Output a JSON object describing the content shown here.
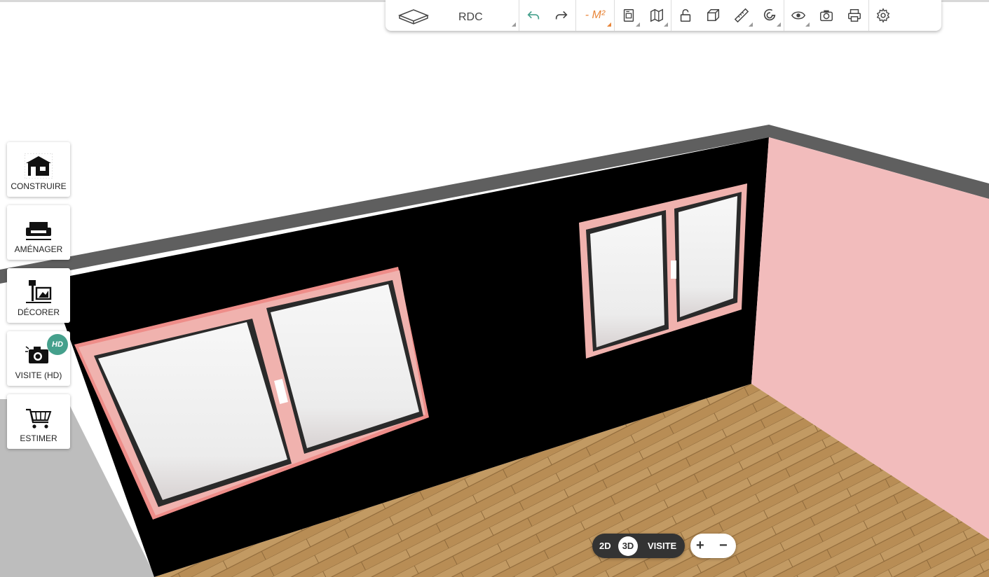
{
  "toolbar": {
    "level_label": "RDC",
    "surface_label": "- M²",
    "buttons": [
      "level-icon",
      "undo-icon",
      "redo-icon",
      "surface",
      "document-icon",
      "map-icon",
      "lock-icon",
      "cube-icon",
      "ruler-icon",
      "magnet-icon",
      "eye-icon",
      "camera-icon",
      "printer-icon",
      "gear-icon"
    ]
  },
  "sidebar": {
    "items": [
      {
        "label": "CONSTRUIRE",
        "icon": "house-icon"
      },
      {
        "label": "AMÉNAGER",
        "icon": "sofa-icon"
      },
      {
        "label": "DÉCORER",
        "icon": "decor-icon"
      },
      {
        "label": "VISITE (HD)",
        "icon": "camera-visit-icon",
        "badge": "HD"
      },
      {
        "label": "ESTIMER",
        "icon": "cart-icon"
      }
    ]
  },
  "view": {
    "modes": [
      "2D",
      "3D",
      "VISITE"
    ],
    "active": "3D",
    "zoom_in": "+",
    "zoom_out": "−"
  },
  "colors": {
    "wall_back": "#000000",
    "wall_side": "#f2bcbc",
    "wall_top": "#5f5f5f",
    "floor": "#b88d55",
    "frame": "#f0b2ae",
    "accent": "#45a08c",
    "orange": "#e8863a"
  }
}
